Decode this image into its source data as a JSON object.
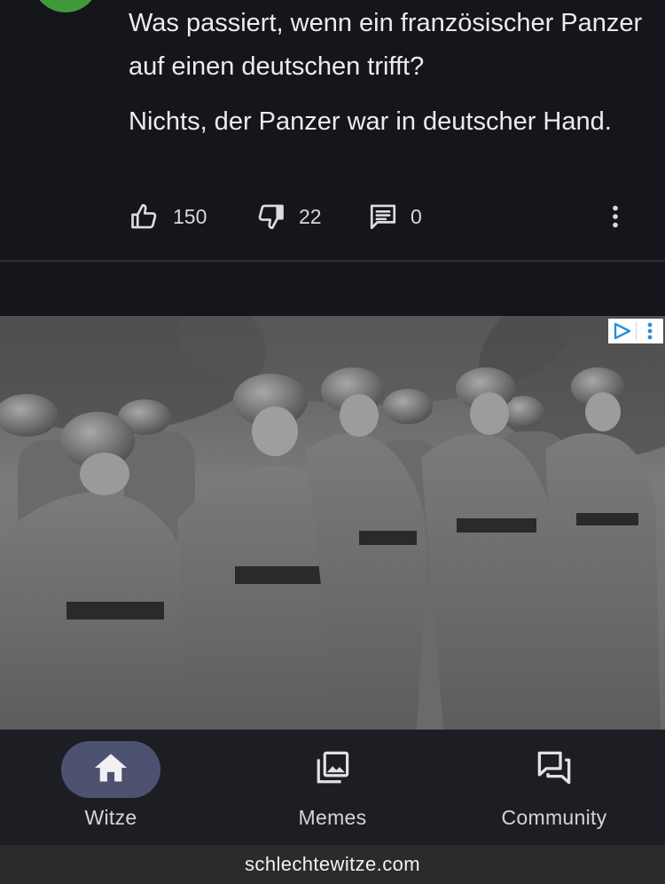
{
  "joke": {
    "question": "Was passiert, wenn ein französischer Panzer auf einen deutschen trifft?",
    "answer": "Nichts, der Panzer war in deutscher Hand.",
    "likes": "150",
    "dislikes": "22",
    "comments": "0"
  },
  "ad": {
    "image": "black-and-white photo of saluting soldiers in uniform",
    "badge_icons": [
      "adchoices-play-icon",
      "more-vertical-icon"
    ]
  },
  "nav": {
    "items": [
      {
        "label": "Witze",
        "icon": "home-icon",
        "active": true
      },
      {
        "label": "Memes",
        "icon": "image-library-icon",
        "active": false
      },
      {
        "label": "Community",
        "icon": "forum-icon",
        "active": false
      }
    ]
  },
  "browser": {
    "url": "schlechtewitze.com"
  },
  "colors": {
    "background": "#15161b",
    "nav_background": "#1d1e24",
    "active_pill": "#4d5270",
    "avatar": "#3f9a3a"
  }
}
